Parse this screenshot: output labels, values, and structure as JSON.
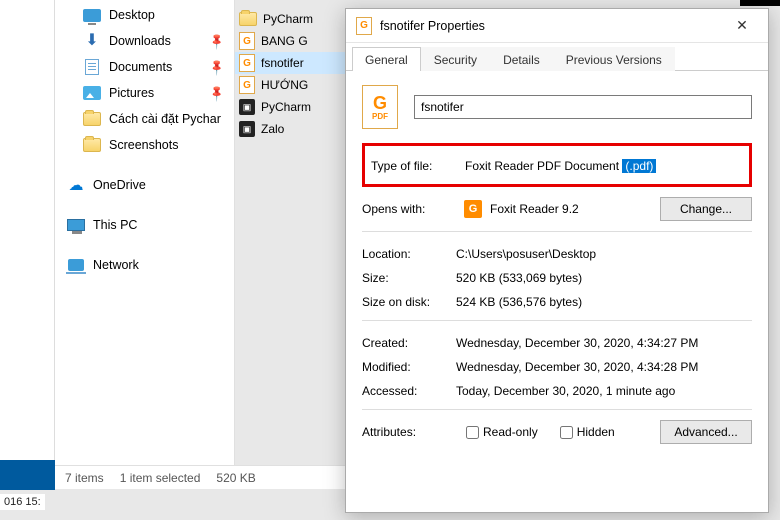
{
  "explorer": {
    "nav": {
      "desktop": "Desktop",
      "downloads": "Downloads",
      "documents": "Documents",
      "pictures": "Pictures",
      "custom1": "Cách cài đặt Pychar",
      "screenshots": "Screenshots",
      "onedrive": "OneDrive",
      "thispc": "This PC",
      "network": "Network"
    },
    "status": {
      "items": "7 items",
      "selected": "1 item selected",
      "size": "520 KB"
    }
  },
  "files": [
    {
      "name": "PyCharm",
      "icon": "folder"
    },
    {
      "name": "BANG G",
      "icon": "pdf"
    },
    {
      "name": "fsnotifer",
      "icon": "pdf",
      "selected": true
    },
    {
      "name": "HƯỚNG",
      "icon": "pdf"
    },
    {
      "name": "PyCharm",
      "icon": "exe"
    },
    {
      "name": "Zalo",
      "icon": "exe"
    }
  ],
  "dialog": {
    "title": "fsnotifer Properties",
    "tabs": [
      "General",
      "Security",
      "Details",
      "Previous Versions"
    ],
    "active_tab": 0,
    "filename": "fsnotifer",
    "type_label": "Type of file:",
    "type_value": "Foxit Reader PDF Document",
    "type_ext": "(.pdf)",
    "opens_label": "Opens with:",
    "opens_value": "Foxit Reader 9.2",
    "change_btn": "Change...",
    "location_label": "Location:",
    "location_value": "C:\\Users\\posuser\\Desktop",
    "size_label": "Size:",
    "size_value": "520 KB (533,069 bytes)",
    "sod_label": "Size on disk:",
    "sod_value": "524 KB (536,576 bytes)",
    "created_label": "Created:",
    "created_value": "Wednesday, December 30, 2020, 4:34:27 PM",
    "modified_label": "Modified:",
    "modified_value": "Wednesday, December 30, 2020, 4:34:28 PM",
    "accessed_label": "Accessed:",
    "accessed_value": "Today, December 30, 2020, 1 minute ago",
    "attributes_label": "Attributes:",
    "readonly_label": "Read-only",
    "hidden_label": "Hidden",
    "advanced_btn": "Advanced..."
  },
  "misc": {
    "bottom_time": "016 15:"
  }
}
